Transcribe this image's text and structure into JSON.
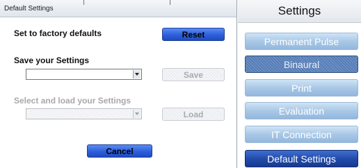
{
  "dialog": {
    "title": "Default Settings",
    "factory_label": "Set to factory defaults",
    "reset_label": "Reset",
    "save_section_label": "Save your Settings",
    "save_select_value": "",
    "save_label": "Save",
    "load_section_label": "Select and load your Settings",
    "load_select_value": "",
    "load_label": "Load",
    "cancel_label": "Cancel"
  },
  "panel": {
    "title": "Settings",
    "items": [
      {
        "label": "Permanent Pulse",
        "state": "normal"
      },
      {
        "label": "Binaural",
        "state": "pressed"
      },
      {
        "label": "Print",
        "state": "normal"
      },
      {
        "label": "Evaluation",
        "state": "normal"
      },
      {
        "label": "IT Connection",
        "state": "normal"
      },
      {
        "label": "Default Settings",
        "state": "selected"
      }
    ]
  }
}
